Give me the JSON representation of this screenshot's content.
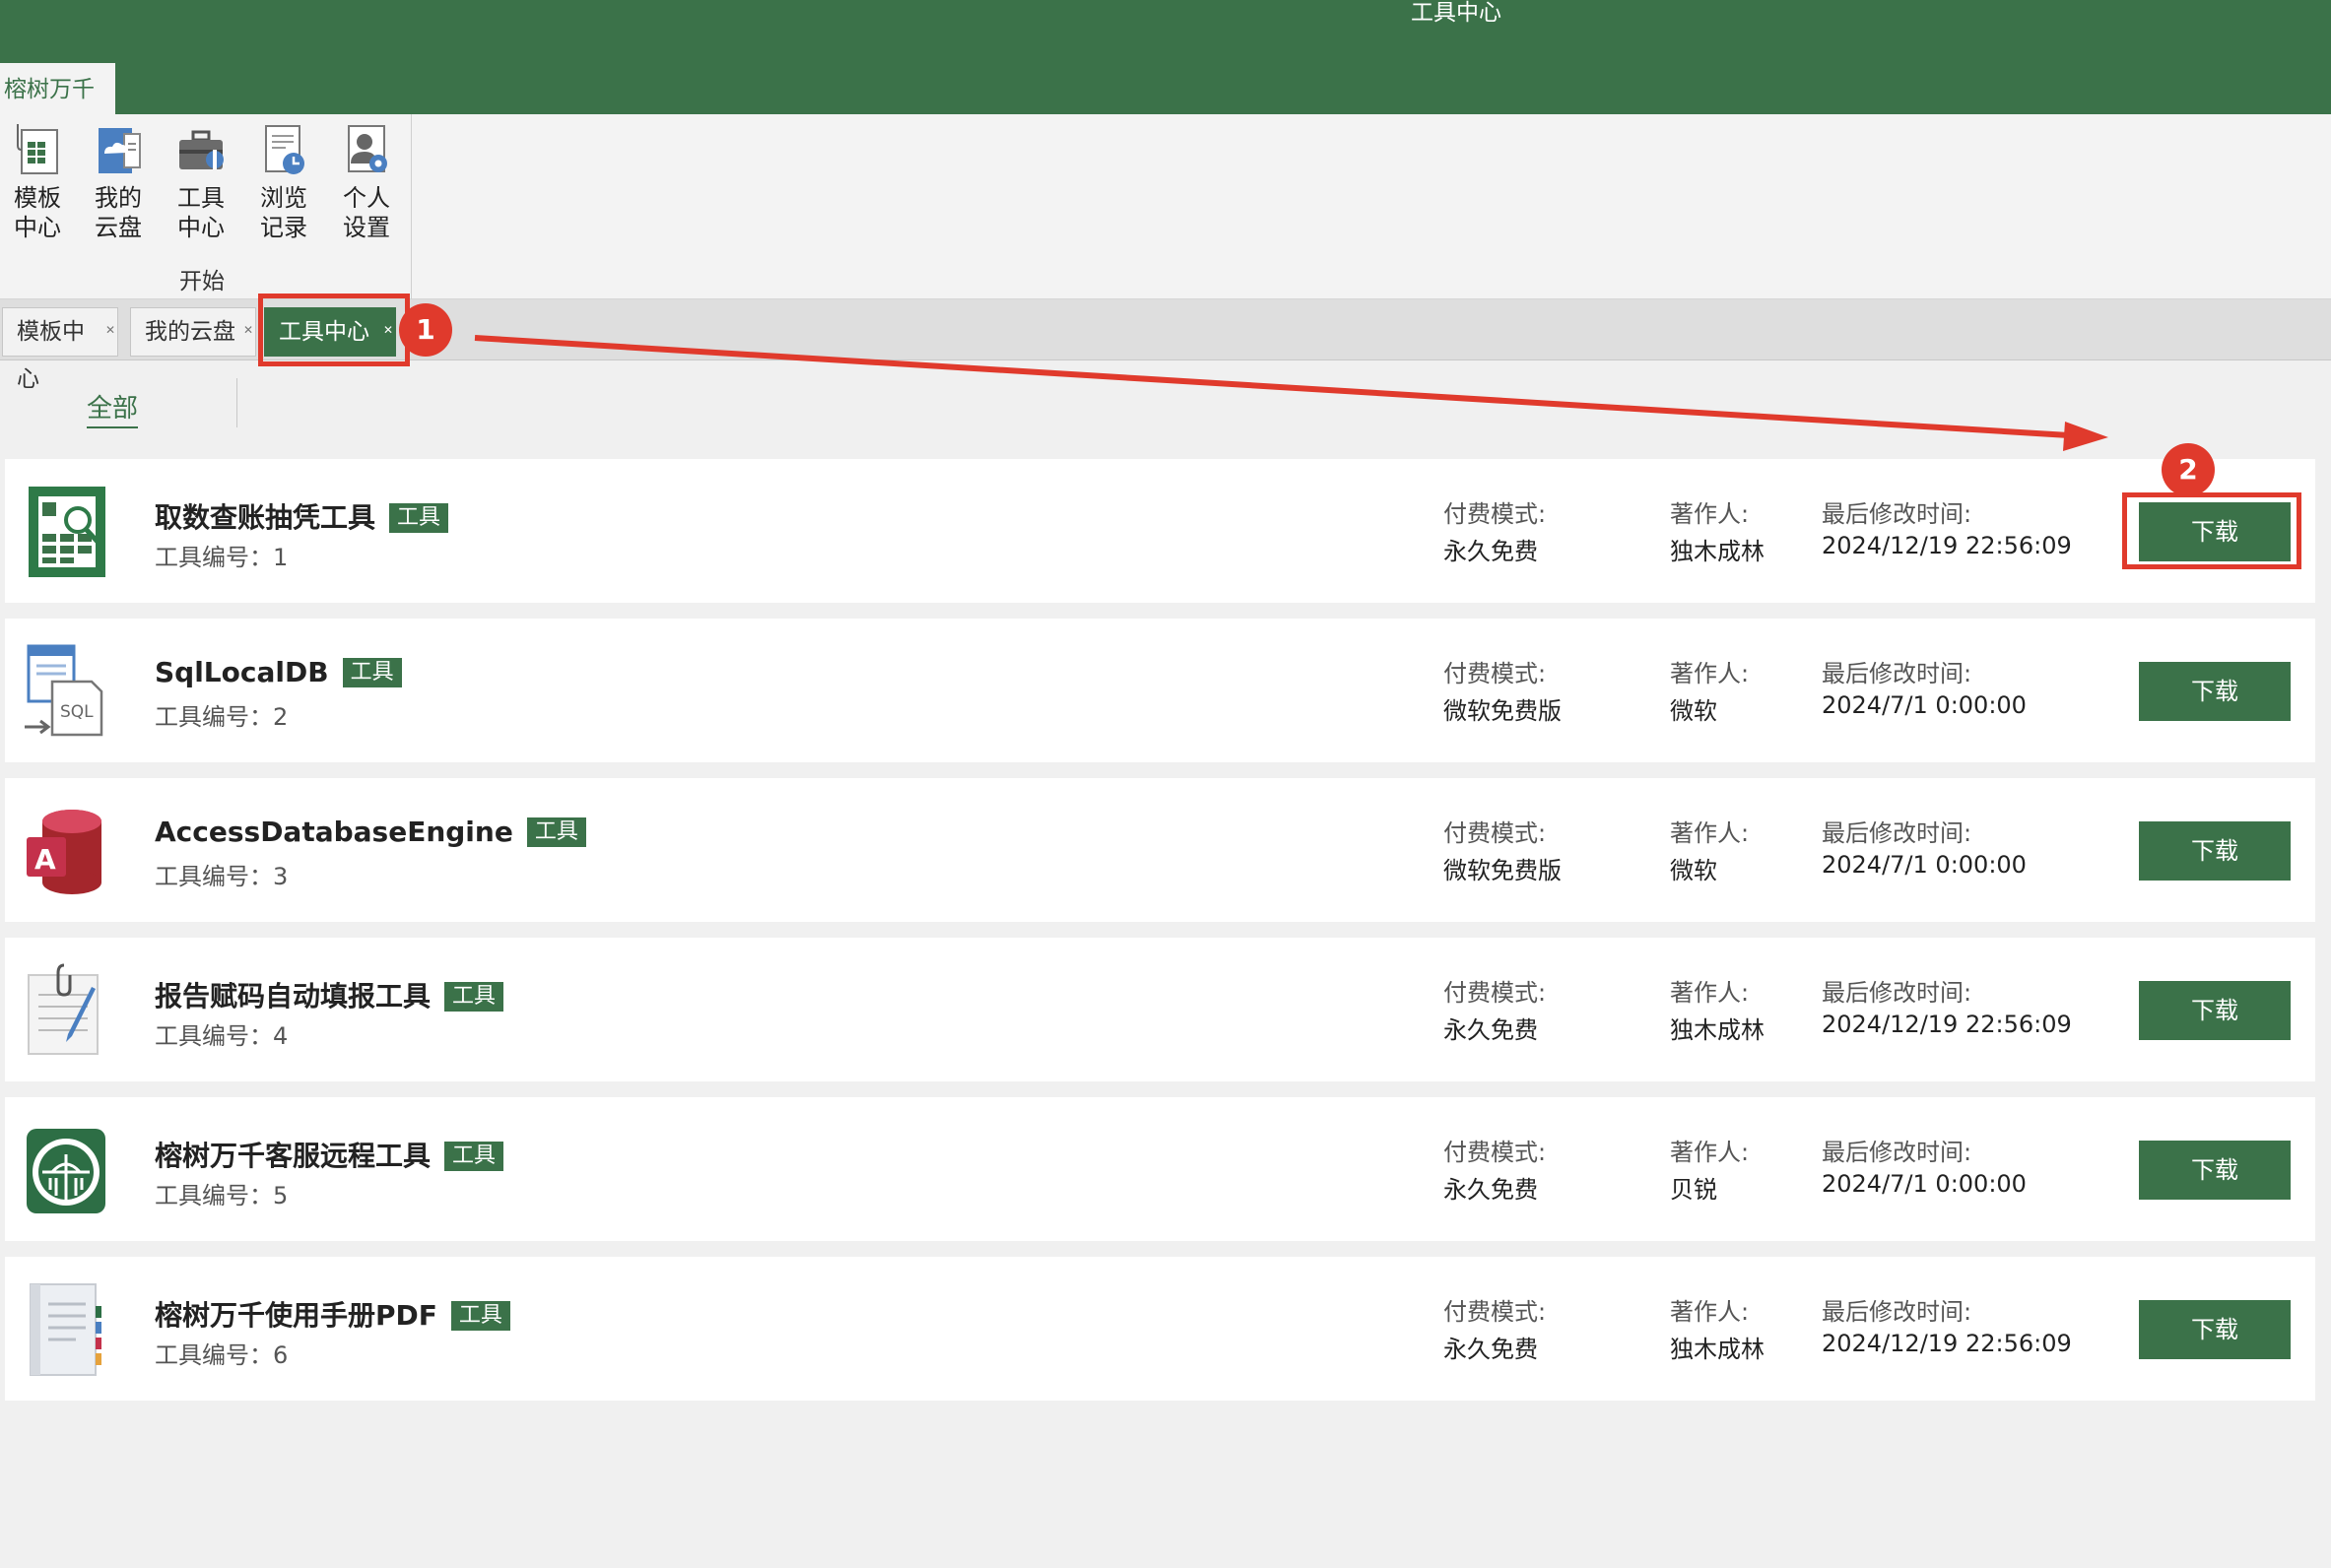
{
  "window": {
    "title": "工具中心"
  },
  "ribbon": {
    "tab_label": "榕树万千",
    "buttons": [
      {
        "label": "模板\n中心",
        "icon": "template-icon"
      },
      {
        "label": "我的\n云盘",
        "icon": "cloud-drive-icon"
      },
      {
        "label": "工具\n中心",
        "icon": "toolbox-icon"
      },
      {
        "label": "浏览\n记录",
        "icon": "history-icon"
      },
      {
        "label": "个人\n设置",
        "icon": "user-settings-icon"
      }
    ],
    "group_label": "开始"
  },
  "doc_tabs": [
    {
      "label": "模板中心",
      "active": false
    },
    {
      "label": "我的云盘",
      "active": false
    },
    {
      "label": "工具中心",
      "active": true
    }
  ],
  "filter": {
    "all_label": "全部"
  },
  "labels": {
    "pay_mode": "付费模式:",
    "author": "著作人:",
    "modified": "最后修改时间:",
    "download": "下载",
    "tag": "工具"
  },
  "tools": [
    {
      "name": "取数查账抽凭工具",
      "code": "工具编号：1",
      "pay": "永久免费",
      "author": "独木成林",
      "modified": "2024/12/19 22:56:09",
      "icon": "spreadsheet-search-icon"
    },
    {
      "name": "SqlLocalDB",
      "code": "工具编号：2",
      "pay": "微软免费版",
      "author": "微软",
      "modified": "2024/7/1 0:00:00",
      "icon": "sql-file-icon"
    },
    {
      "name": "AccessDatabaseEngine",
      "code": "工具编号：3",
      "pay": "微软免费版",
      "author": "微软",
      "modified": "2024/7/1 0:00:00",
      "icon": "access-database-icon"
    },
    {
      "name": "报告赋码自动填报工具",
      "code": "工具编号：4",
      "pay": "永久免费",
      "author": "独木成林",
      "modified": "2024/12/19 22:56:09",
      "icon": "document-pen-icon"
    },
    {
      "name": "榕树万千客服远程工具",
      "code": "工具编号：5",
      "pay": "永久免费",
      "author": "贝锐",
      "modified": "2024/7/1 0:00:00",
      "icon": "remote-support-logo-icon"
    },
    {
      "name": "榕树万千使用手册PDF",
      "code": "工具编号：6",
      "pay": "永久免费",
      "author": "独木成林",
      "modified": "2024/12/19 22:56:09",
      "icon": "manual-notebook-icon"
    }
  ],
  "annotations": {
    "step1": "1",
    "step2": "2",
    "color": "#e03a2c"
  },
  "colors": {
    "brand_green": "#3b7249"
  }
}
